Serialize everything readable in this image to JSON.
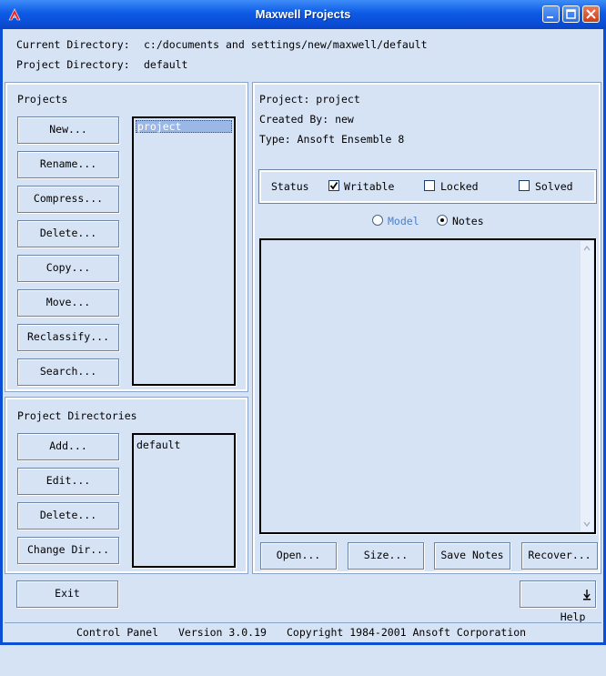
{
  "window": {
    "title": "Maxwell Projects"
  },
  "header": {
    "current_dir_label": "Current Directory:",
    "current_dir_value": "c:/documents and settings/new/maxwell/default",
    "project_dir_label": "Project Directory:",
    "project_dir_value": "default"
  },
  "projects": {
    "title": "Projects",
    "buttons": [
      "New...",
      "Rename...",
      "Compress...",
      "Delete...",
      "Copy...",
      "Move...",
      "Reclassify...",
      "Search..."
    ],
    "list": [
      "project"
    ],
    "selected_index": 0
  },
  "project_directories": {
    "title": "Project Directories",
    "buttons": [
      "Add...",
      "Edit...",
      "Delete...",
      "Change Dir..."
    ],
    "list": [
      "default"
    ]
  },
  "info": {
    "project": "Project: project",
    "created_by": "Created By: new",
    "type": "Type: Ansoft Ensemble 8"
  },
  "status": {
    "label": "Status",
    "writable_label": "Writable",
    "writable": true,
    "locked_label": "Locked",
    "locked": false,
    "solved_label": "Solved",
    "solved": false
  },
  "view": {
    "model_label": "Model",
    "notes_label": "Notes",
    "selected": "Notes"
  },
  "notes_text": "",
  "notes_buttons": [
    "Open...",
    "Size...",
    "Save Notes",
    "Recover..."
  ],
  "footer": {
    "exit_label": "Exit",
    "help_label": "Help"
  },
  "statusbar": {
    "app": "Control Panel",
    "version": "Version 3.0.19",
    "copyright": "Copyright 1984-2001 Ansoft Corporation"
  },
  "icons": {
    "app": "ansoft-logo-icon",
    "minimize": "minimize-icon",
    "maximize": "maximize-icon",
    "close": "close-icon",
    "help_arrow": "down-arrow-icon",
    "checkmark": "checkmark-icon"
  },
  "colors": {
    "titlebar": "#0a4ed6",
    "window_bg": "#d6e3f5",
    "selection": "#9bb7e5"
  }
}
